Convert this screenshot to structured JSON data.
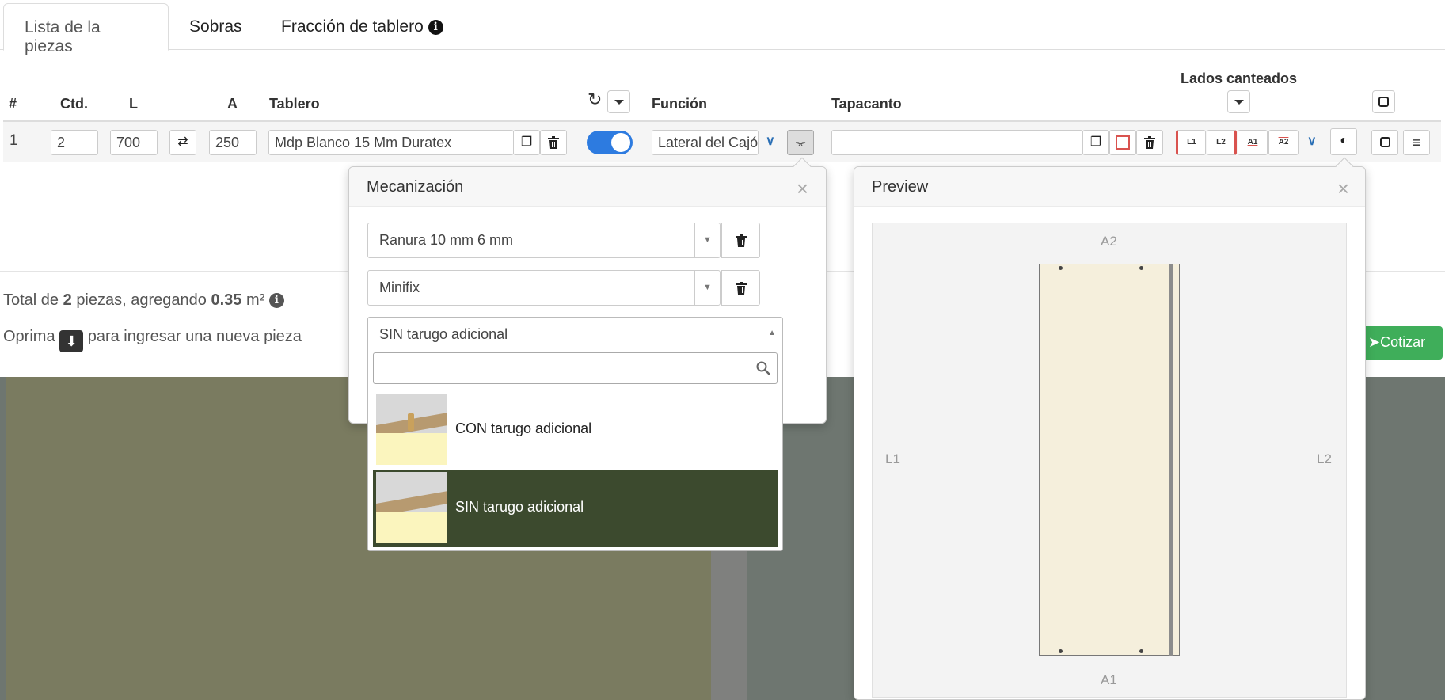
{
  "tabs": [
    {
      "label": "Lista de la piezas"
    },
    {
      "label": "Sobras"
    },
    {
      "label": "Fracción de tablero"
    }
  ],
  "table": {
    "headers": {
      "num": "#",
      "qty": "Ctd.",
      "length": "L",
      "width": "A",
      "board": "Tablero",
      "function": "Función",
      "edging": "Tapacanto",
      "edged_sides": "Lados canteados"
    },
    "row": {
      "num": "1",
      "qty": "2",
      "length": "700",
      "width": "250",
      "board": "Mdp Blanco 15 Mm Duratex",
      "function": "Lateral del Cajón",
      "edging": "",
      "edges": [
        "L1",
        "L2",
        "A1",
        "A2"
      ],
      "toggle_on": true
    }
  },
  "totals": {
    "prefix": "Total de",
    "pieces": "2",
    "middle": "piezas, agregando",
    "area": "0.35",
    "unit": "m²"
  },
  "hint": {
    "before": "Oprima",
    "after": "para ingresar una nueva pieza"
  },
  "cotizar_label": "Cotizar",
  "mecanizacion": {
    "title": "Mecanización",
    "selects": [
      {
        "value": "Ranura 10 mm 6 mm"
      },
      {
        "value": "Minifix"
      },
      {
        "value": "SIN tarugo adicional"
      }
    ],
    "options": [
      {
        "label": "CON tarugo adicional",
        "selected": false
      },
      {
        "label": "SIN tarugo adicional",
        "selected": true
      }
    ]
  },
  "preview": {
    "title": "Preview",
    "labels": {
      "top": "A2",
      "bottom": "A1",
      "left": "L1",
      "right": "L2"
    }
  },
  "colors": {
    "toggle": "#2d7be0",
    "selected_option": "#3c4a2e",
    "cotizar": "#3fae5a",
    "edge_red": "#d9534f"
  }
}
